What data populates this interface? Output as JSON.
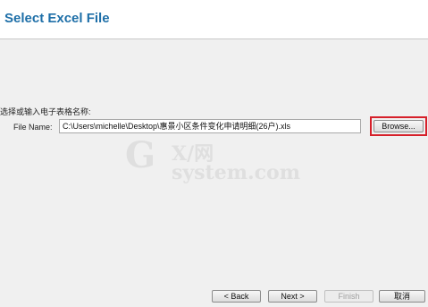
{
  "header": {
    "title": "Select Excel File"
  },
  "form": {
    "prompt": "选择或输入电子表格名称:",
    "file_label": "File Name:",
    "file_value": "C:\\Users\\michelle\\Desktop\\惠景小区条件变化申请明细(26户).xls",
    "browse_label": "Browse..."
  },
  "watermark": {
    "g": "G",
    "main": "X/网",
    "sub": "system.com"
  },
  "footer": {
    "back_label": "< Back",
    "next_label": "Next >",
    "finish_label": "Finish",
    "cancel_label": "取消"
  },
  "colors": {
    "title": "#1e6fa8",
    "highlight": "#d6202a"
  }
}
